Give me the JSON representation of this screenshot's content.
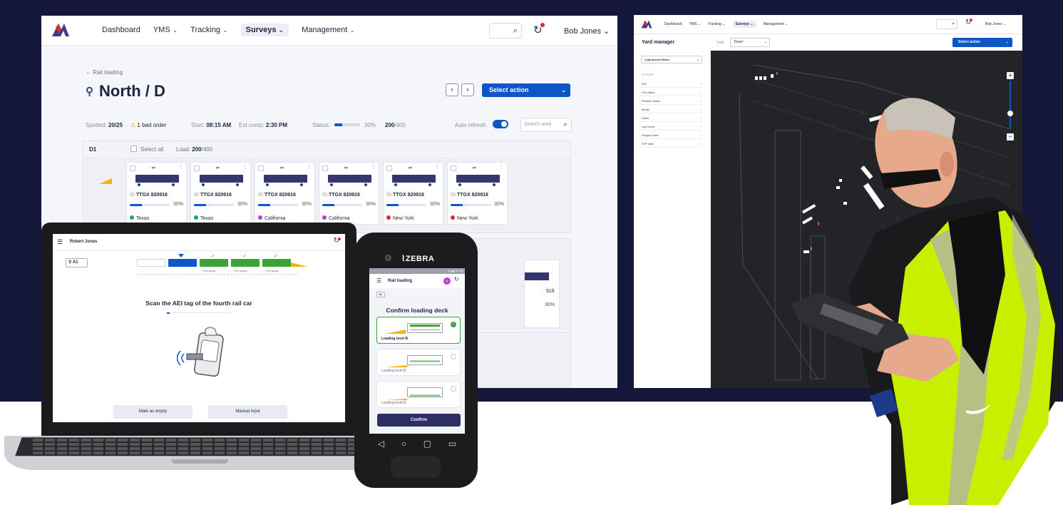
{
  "main": {
    "nav": {
      "dashboard": "Dashboard",
      "yms": "YMS",
      "tracking": "Tracking",
      "surveys": "Surveys",
      "management": "Management",
      "user": "Bob Jones"
    },
    "breadcrumb": "← Rail loading",
    "title": "North / D",
    "select_action": "Select action",
    "stats": {
      "spotted_label": "Spotted:",
      "spotted_value": "20/25",
      "bad_order": "1 bad order",
      "start_label": "Start:",
      "start_value": "08:15 AM",
      "est_label": "Est comp:",
      "est_value": "2:30 PM",
      "status_label": "Status:",
      "status_progress": 0.3,
      "status_pct": "30%",
      "count_value": "200",
      "count_total": "/400",
      "auto_refresh": "Auto refresh",
      "search_placeholder": "Search area"
    },
    "section": {
      "id": "D1",
      "select_all": "Select all",
      "load_label": "Load:",
      "load_value": "200",
      "load_total": "/400"
    },
    "cars": [
      {
        "id": "TTGX 820916",
        "progress": 0.3,
        "pct": "30%",
        "location": "Texas",
        "loc_color": "#18a37f"
      },
      {
        "id": "TTGX 820916",
        "progress": 0.3,
        "pct": "30%",
        "location": "Texas",
        "loc_color": "#18a37f"
      },
      {
        "id": "TTGX 820916",
        "progress": 0.3,
        "pct": "30%",
        "location": "California",
        "loc_color": "#c03ad6"
      },
      {
        "id": "TTGX 820916",
        "progress": 0.3,
        "pct": "30%",
        "location": "California",
        "loc_color": "#c03ad6"
      },
      {
        "id": "TTGX 820916",
        "progress": 0.3,
        "pct": "30%",
        "location": "New York",
        "loc_color": "#e8262f"
      },
      {
        "id": "TTGX 820916",
        "progress": 0.3,
        "pct": "30%",
        "location": "New York",
        "loc_color": "#e8262f"
      }
    ],
    "peek": {
      "id": "916",
      "pct": "30%"
    }
  },
  "yard": {
    "nav": {
      "dashboard": "Dashboard",
      "yms": "YMS",
      "tracking": "Tracking",
      "surveys": "Surveys",
      "management": "Management",
      "user": "Bob Jones"
    },
    "title": "Yard manager",
    "yard_label": "Yard",
    "yard_value": "Tower",
    "select_action": "Select action",
    "preset": "Load preset filters",
    "filters_heading": "FILTERS",
    "filters": [
      "VIN",
      "VIN status",
      "Position status",
      "Model",
      "Holds",
      "Last move",
      "Shipped date",
      "RTP date"
    ]
  },
  "laptop": {
    "user": "Robert Jones",
    "location": "A1",
    "car_labels": [
      "TTGX 820916",
      "TTGX 820916",
      "TTGX 820916"
    ],
    "prompt_pre": "Scan the AEI tag of the ",
    "prompt_bold": "fourth",
    "prompt_post": " rail car",
    "btn_empty": "Mark as empty",
    "btn_manual": "Manual input"
  },
  "phone": {
    "brand": "ZEBRA",
    "time": "12:30",
    "title": "Rail loading",
    "tag": "A1",
    "heading": "Confirm loading deck",
    "decks": [
      "Loading level B",
      "Loading level B",
      "Loading level B"
    ],
    "confirm": "Confirm"
  },
  "colors": {
    "navy": "#14163a",
    "primary": "#0e55c5",
    "railcar": "#34376f",
    "success": "#3aa33a",
    "warning": "#f4b400",
    "alert": "#e8262f"
  },
  "icons": [
    "logo-icon",
    "search-icon",
    "refresh-icon",
    "location-pin-icon",
    "chevron-left-icon",
    "chevron-right-icon",
    "chevron-down-icon",
    "warning-icon",
    "menu-icon",
    "check-icon",
    "back-icon",
    "home-icon",
    "recent-apps-icon",
    "signal-icon"
  ]
}
